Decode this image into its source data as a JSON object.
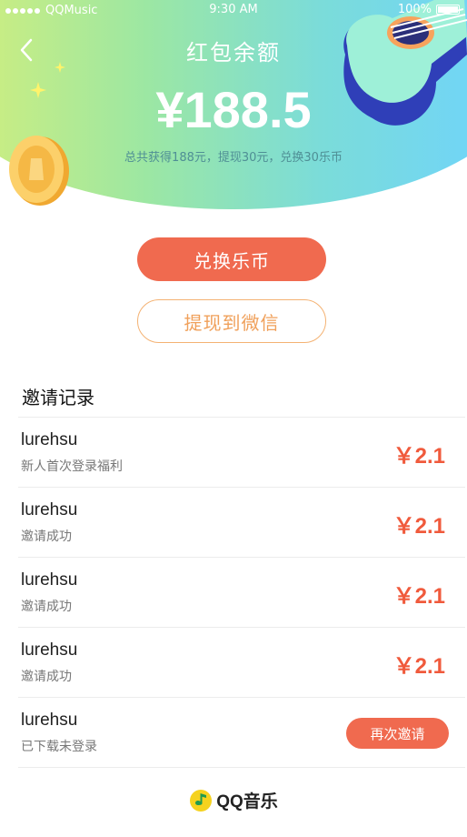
{
  "status_bar": {
    "carrier": "QQMusic",
    "time": "9:30 AM",
    "battery": "100%"
  },
  "header": {
    "title": "红包余额",
    "balance": "¥188.5",
    "summary": "总共获得188元，提现30元，兑换30乐币"
  },
  "actions": {
    "exchange_label": "兑换乐币",
    "withdraw_label": "提现到微信"
  },
  "records": {
    "title": "邀请记录",
    "items": [
      {
        "name": "lurehsu",
        "desc": "新人首次登录福利",
        "amount": "￥2.1"
      },
      {
        "name": "lurehsu",
        "desc": "邀请成功",
        "amount": "￥2.1"
      },
      {
        "name": "lurehsu",
        "desc": "邀请成功",
        "amount": "￥2.1"
      },
      {
        "name": "lurehsu",
        "desc": "邀请成功",
        "amount": "￥2.1"
      },
      {
        "name": "lurehsu",
        "desc": "已下载未登录",
        "button": "再次邀请"
      }
    ]
  },
  "footer": {
    "logo_text": "QQ音乐"
  },
  "colors": {
    "accent": "#f06a4f",
    "amount": "#f05a3c",
    "withdraw_border": "#f4b273",
    "header_gradient": [
      "#d6ef7a",
      "#6ed3ff"
    ]
  },
  "icons": {
    "back": "chevron-left-icon",
    "logo": "qq-music-logo-icon"
  }
}
